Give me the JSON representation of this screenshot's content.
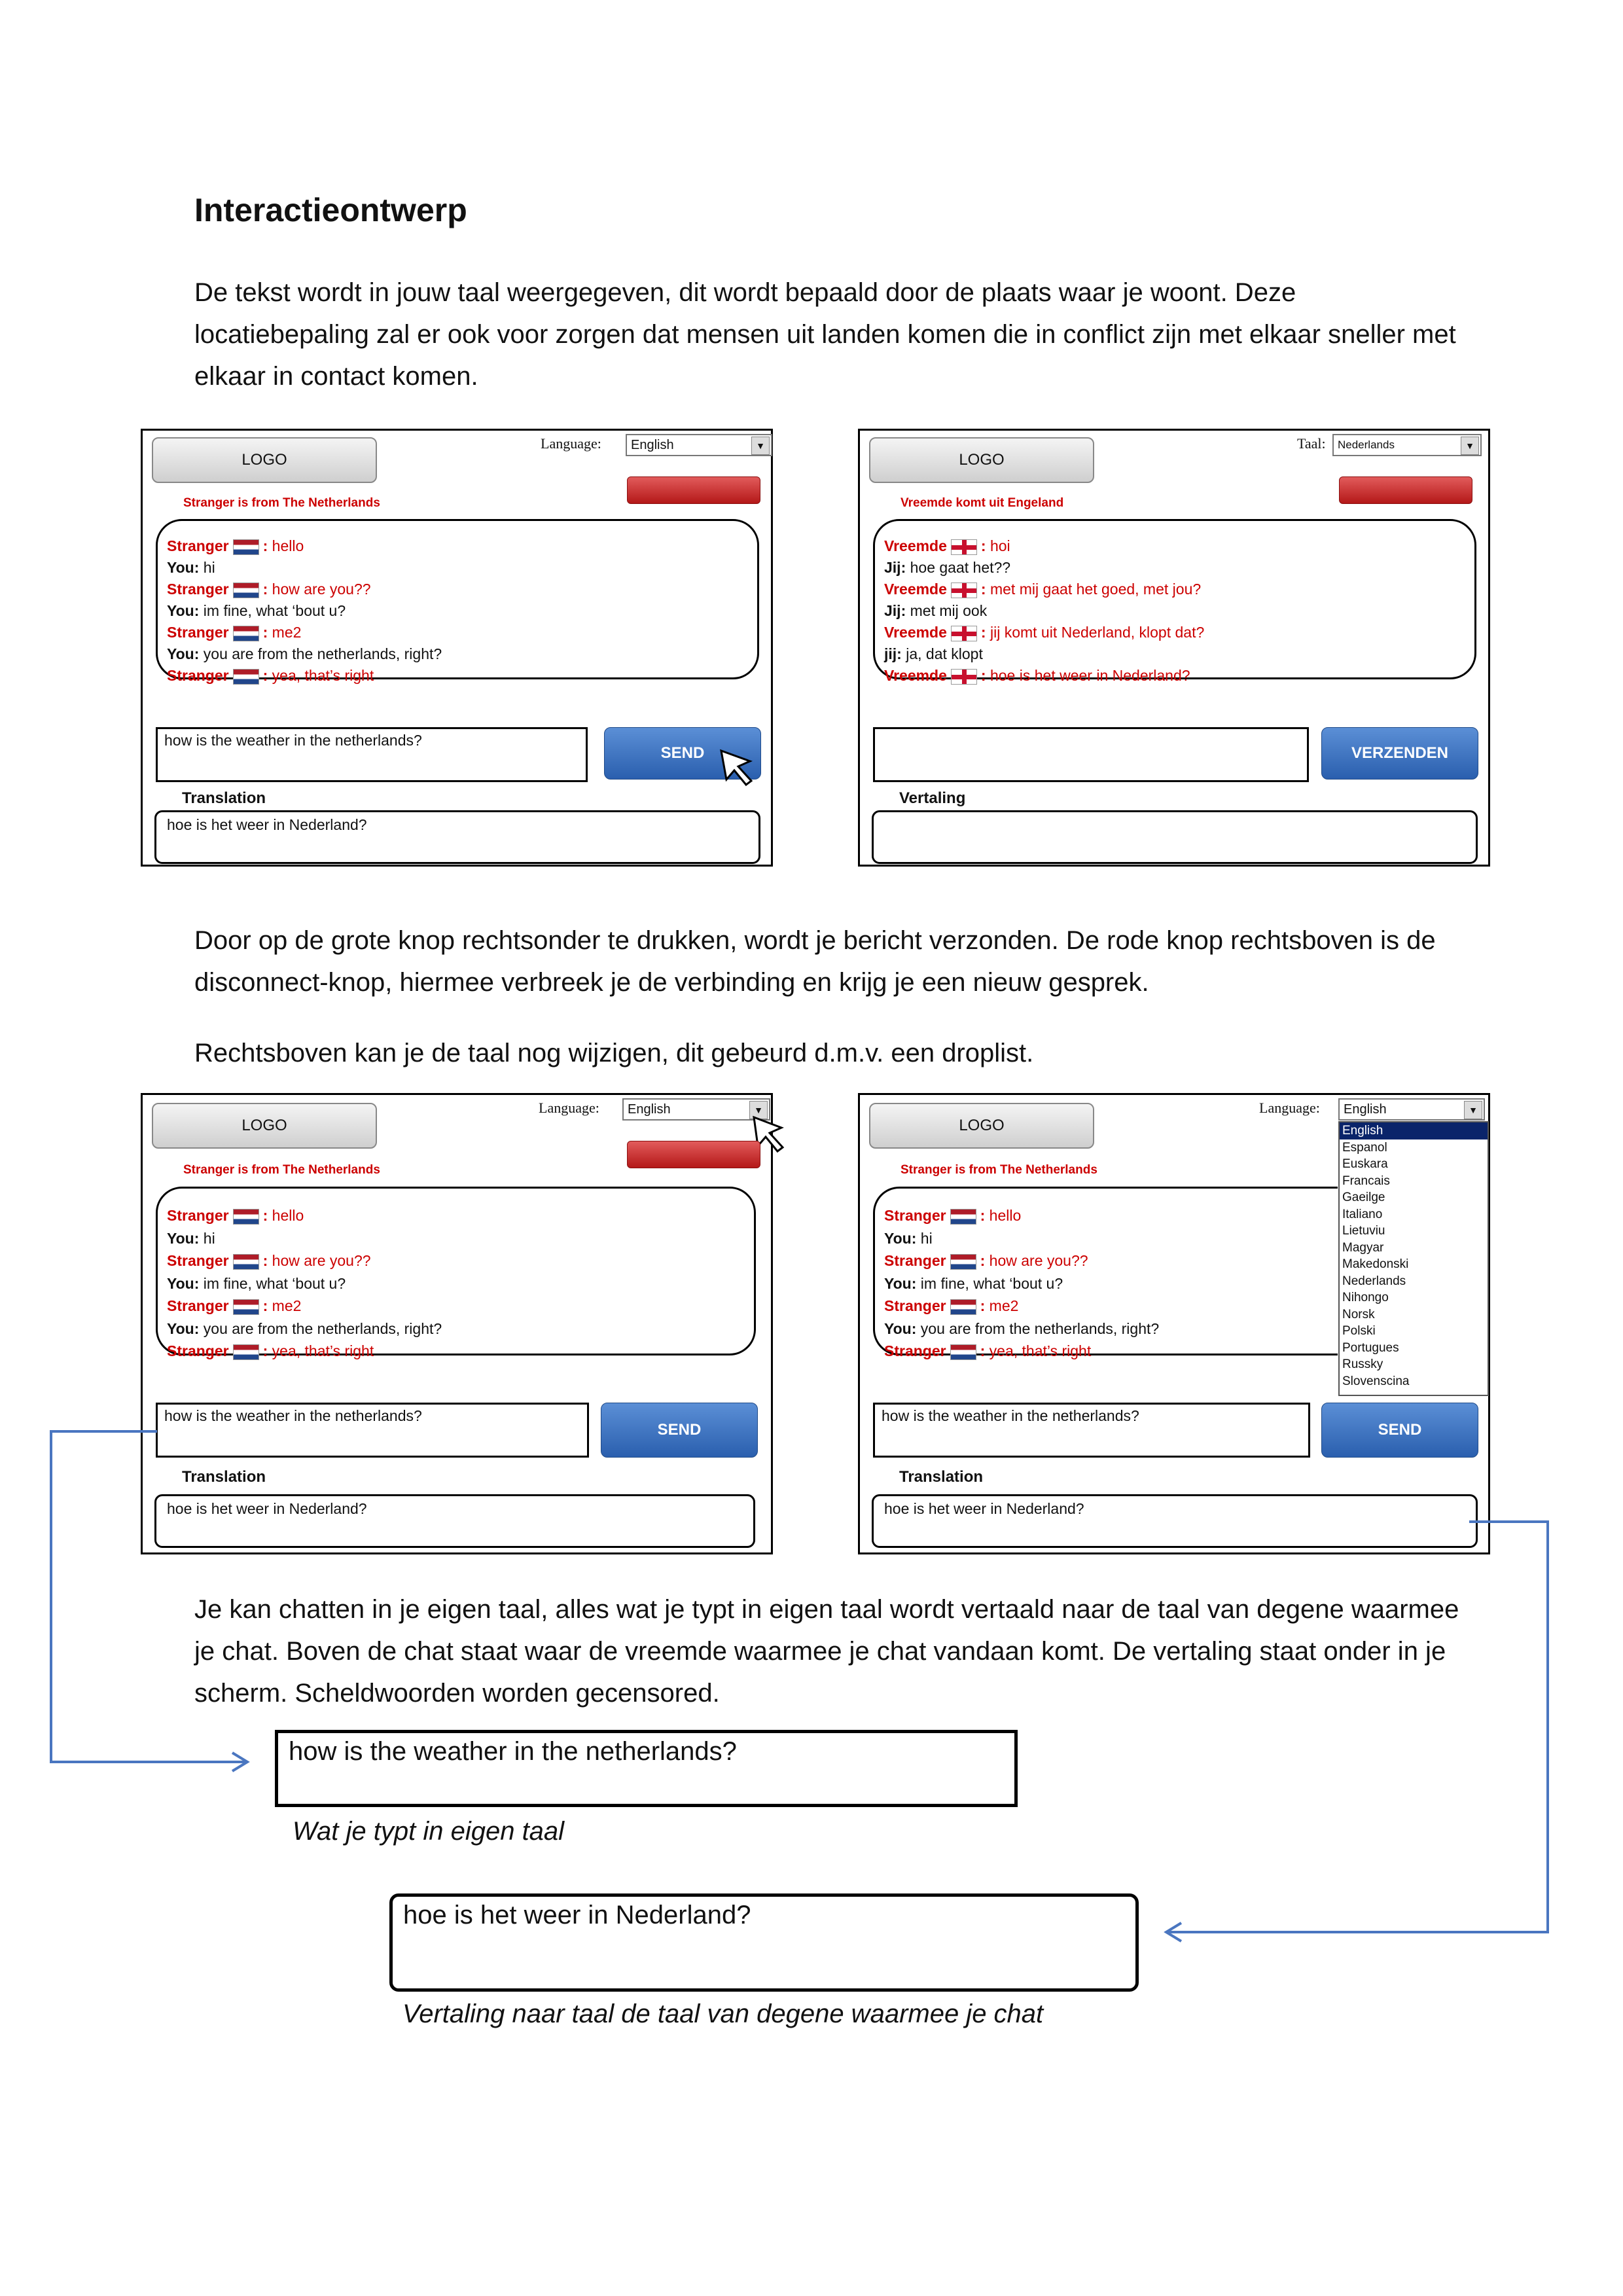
{
  "title": "Interactieontwerp",
  "paragraphs": {
    "p1": "De tekst wordt in jouw taal weergegeven, dit wordt bepaald door de plaats waar je woont. Deze locatiebepaling zal er ook voor zorgen dat mensen uit landen komen die in conflict zijn met elkaar sneller met elkaar in contact komen.",
    "p2": "Door op de grote knop rechtsonder te drukken, wordt je bericht verzonden. De rode knop rechtsboven is de disconnect-knop, hiermee verbreek je de verbinding en krijg je een nieuw gesprek.",
    "p3": "Rechtsboven kan je de taal nog wijzigen, dit gebeurd d.m.v. een droplist.",
    "p4": "Je kan chatten in je eigen taal, alles wat je typt in eigen taal wordt vertaald naar de taal van degene waarmee je chat. Boven de chat staat waar de vreemde waarmee je chat vandaan komt. De vertaling staat onder in je scherm.  Scheldwoorden worden gecensored."
  },
  "mock_en": {
    "logo": "LOGO",
    "language_label": "Language:",
    "language_value": "English",
    "origin": "Stranger is from The Netherlands",
    "messages": [
      {
        "who": "Stranger",
        "text": "hello",
        "stranger": true
      },
      {
        "who": "You:",
        "text": "hi",
        "stranger": false
      },
      {
        "who": "Stranger",
        "text": "how are you??",
        "stranger": true
      },
      {
        "who": "You:",
        "text": "im fine, what ‘bout u?",
        "stranger": false
      },
      {
        "who": "Stranger",
        "text": "me2",
        "stranger": true
      },
      {
        "who": "You:",
        "text": "you are from the netherlands, right?",
        "stranger": false
      },
      {
        "who": "Stranger",
        "text": "yea, that’s right",
        "stranger": true
      }
    ],
    "input_value": "how is the weather in the netherlands?",
    "send": "SEND",
    "translation_label": "Translation",
    "translation_value": "hoe is het weer in Nederland?"
  },
  "mock_nl": {
    "logo": "LOGO",
    "language_label": "Taal:",
    "language_value": "Nederlands",
    "origin": "Vreemde komt uit Engeland",
    "messages": [
      {
        "who": "Vreemde",
        "text": "hoi",
        "stranger": true
      },
      {
        "who": "Jij:",
        "text": "hoe gaat het??",
        "stranger": false
      },
      {
        "who": "Vreemde",
        "text": "met mij gaat het goed, met jou?",
        "stranger": true
      },
      {
        "who": "Jij:",
        "text": "met mij ook",
        "stranger": false
      },
      {
        "who": "Vreemde",
        "text": "jij komt uit Nederland, klopt dat?",
        "stranger": true
      },
      {
        "who": "jij:",
        "text": "ja, dat klopt",
        "stranger": false
      },
      {
        "who": "Vreemde",
        "text": "hoe is het weer in Nederland?",
        "stranger": true
      }
    ],
    "input_value": "",
    "send": "VERZENDEN",
    "translation_label": "Vertaling",
    "translation_value": ""
  },
  "droplist_options": [
    "English",
    "Espanol",
    "Euskara",
    "Francais",
    "Gaeilge",
    "Italiano",
    "Lietuviu",
    "Magyar",
    "Makedonski",
    "Nederlands",
    "Nihongo",
    "Norsk",
    "Polski",
    "Portugues",
    "Russky",
    "Slovenscina"
  ],
  "captions": {
    "typed": "Wat je typt in eigen taal",
    "translated": "Vertaling naar taal de taal van degene waarmee je chat"
  },
  "big_boxes": {
    "typed": "how is the weather in the netherlands?",
    "translated": "hoe is het weer in Nederland?"
  },
  "icons": [
    "flag-netherlands-icon",
    "flag-england-icon",
    "pointer-cursor-icon",
    "dropdown-arrow-icon"
  ],
  "colors": {
    "accent_red": "#cc0000",
    "send_blue": "#2a5fae",
    "arrow_blue": "#4a76c0"
  }
}
